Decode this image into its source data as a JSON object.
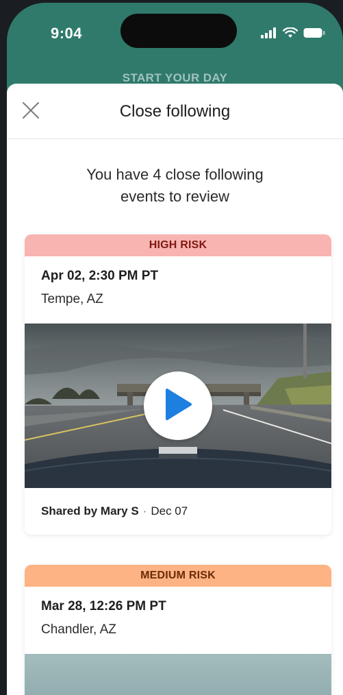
{
  "status_bar": {
    "time": "9:04"
  },
  "background_title": "START YOUR DAY",
  "sheet": {
    "title": "Close following",
    "intro_line1": "You have 4 close following",
    "intro_line2": "events to review"
  },
  "events": [
    {
      "risk": "HIGH RISK",
      "datetime": "Apr 02, 2:30 PM PT",
      "location": "Tempe, AZ",
      "shared_by": "Shared by Mary S",
      "shared_date": "Dec 07",
      "risk_color": "#f8b4b0"
    },
    {
      "risk": "MEDIUM RISK",
      "datetime": "Mar 28, 12:26 PM PT",
      "location": "Chandler, AZ",
      "risk_color": "#fdb383"
    }
  ],
  "colors": {
    "header_bg": "#2f7a6b",
    "play_icon": "#1d7fe0"
  },
  "icons": {
    "close": "close-icon",
    "play": "play-icon",
    "signal": "signal-icon",
    "wifi": "wifi-icon",
    "battery": "battery-icon"
  }
}
